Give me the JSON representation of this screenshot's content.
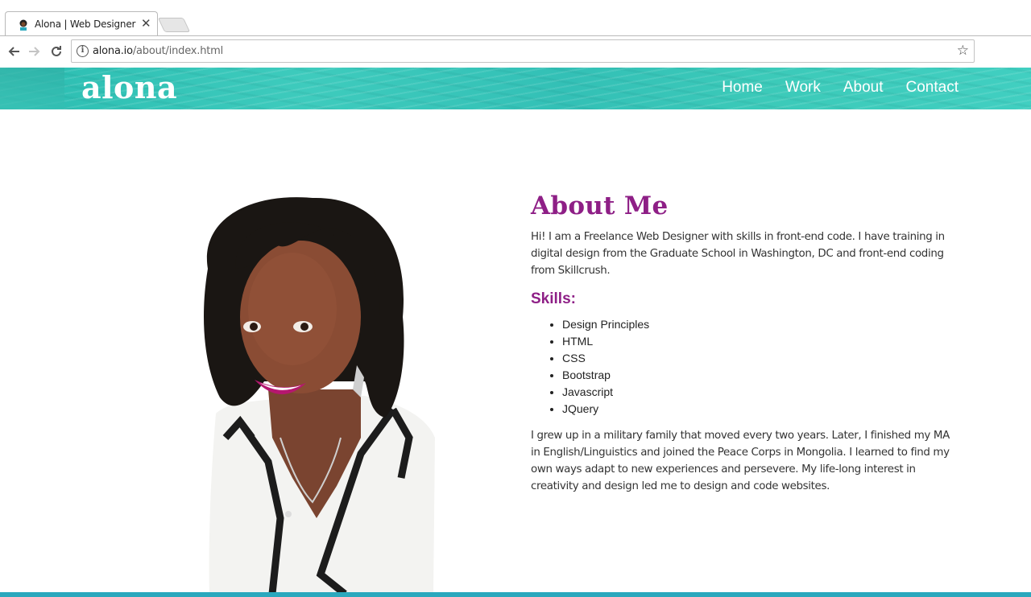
{
  "browser": {
    "tab_title": "Alona | Web Designer",
    "tab_close": "✕",
    "url_host": "alona.io",
    "url_path": "/about/index.html"
  },
  "header": {
    "logo": "alona",
    "nav": [
      "Home",
      "Work",
      "About",
      "Contact"
    ]
  },
  "about": {
    "title": "About Me",
    "intro": "Hi! I am a Freelance Web Designer with skills in front-end code. I have training in digital design from the Graduate School in Washington, DC and front-end coding from Skillcrush.",
    "skills_title": "Skills:",
    "skills": [
      "Design Principles",
      "HTML",
      "CSS",
      "Bootstrap",
      "Javascript",
      "JQuery"
    ],
    "bio": "I grew up in a military family that moved every two years. Later, I finished my MA in English/Linguistics and joined the Peace Corps in Mongolia. I learned to find my own ways adapt to new experiences and persevere. My life-long interest in creativity and design led me to design and code websites."
  },
  "colors": {
    "accent": "#8e1f86",
    "header": "#3cc6b7",
    "footer": "#2aa8bd"
  },
  "icons": {
    "back": "back-arrow-icon",
    "forward": "forward-arrow-icon",
    "reload": "reload-icon",
    "info": "info-icon",
    "star": "star-icon"
  }
}
